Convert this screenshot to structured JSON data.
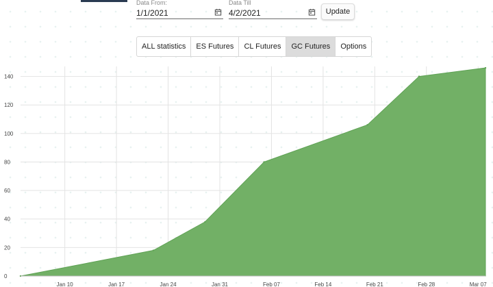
{
  "filters": {
    "date_from": {
      "label": "Data From:",
      "value": "1/1/2021"
    },
    "date_till": {
      "label": "Data Till",
      "value": "4/2/2021"
    },
    "update_label": "Update"
  },
  "tabs": [
    {
      "label": "ALL statistics",
      "active": false
    },
    {
      "label": "ES Futures",
      "active": false
    },
    {
      "label": "CL Futures",
      "active": false
    },
    {
      "label": "GC Futures",
      "active": true
    },
    {
      "label": "Options",
      "active": false
    }
  ],
  "colors": {
    "area_fill": "#72b066",
    "area_edge": "#5fa255",
    "grid": "#e3e3e3",
    "active_tab": "#dcdcdc"
  },
  "chart_data": {
    "type": "area",
    "title": "",
    "xlabel": "",
    "ylabel": "",
    "x_ticks": [
      "Jan 10",
      "Jan 17",
      "Jan 24",
      "Jan 31",
      "Feb 07",
      "Feb 14",
      "Feb 21",
      "Feb 28",
      "Mar 07"
    ],
    "x_tick_dates": [
      "2021-01-10",
      "2021-01-17",
      "2021-01-24",
      "2021-01-31",
      "2021-02-07",
      "2021-02-14",
      "2021-02-21",
      "2021-02-28",
      "2021-03-07"
    ],
    "xlim": [
      "2021-01-04",
      "2021-03-08"
    ],
    "y_ticks": [
      0,
      20,
      40,
      60,
      80,
      100,
      120,
      140
    ],
    "ylim": [
      0,
      147
    ],
    "grid": true,
    "legend": "none",
    "series": [
      {
        "x": [
          "2021-01-04",
          "2021-01-22",
          "2021-01-29",
          "2021-02-06",
          "2021-02-20",
          "2021-02-27",
          "2021-03-08"
        ],
        "y": [
          0,
          18,
          38,
          80,
          106,
          140,
          146
        ]
      }
    ]
  }
}
